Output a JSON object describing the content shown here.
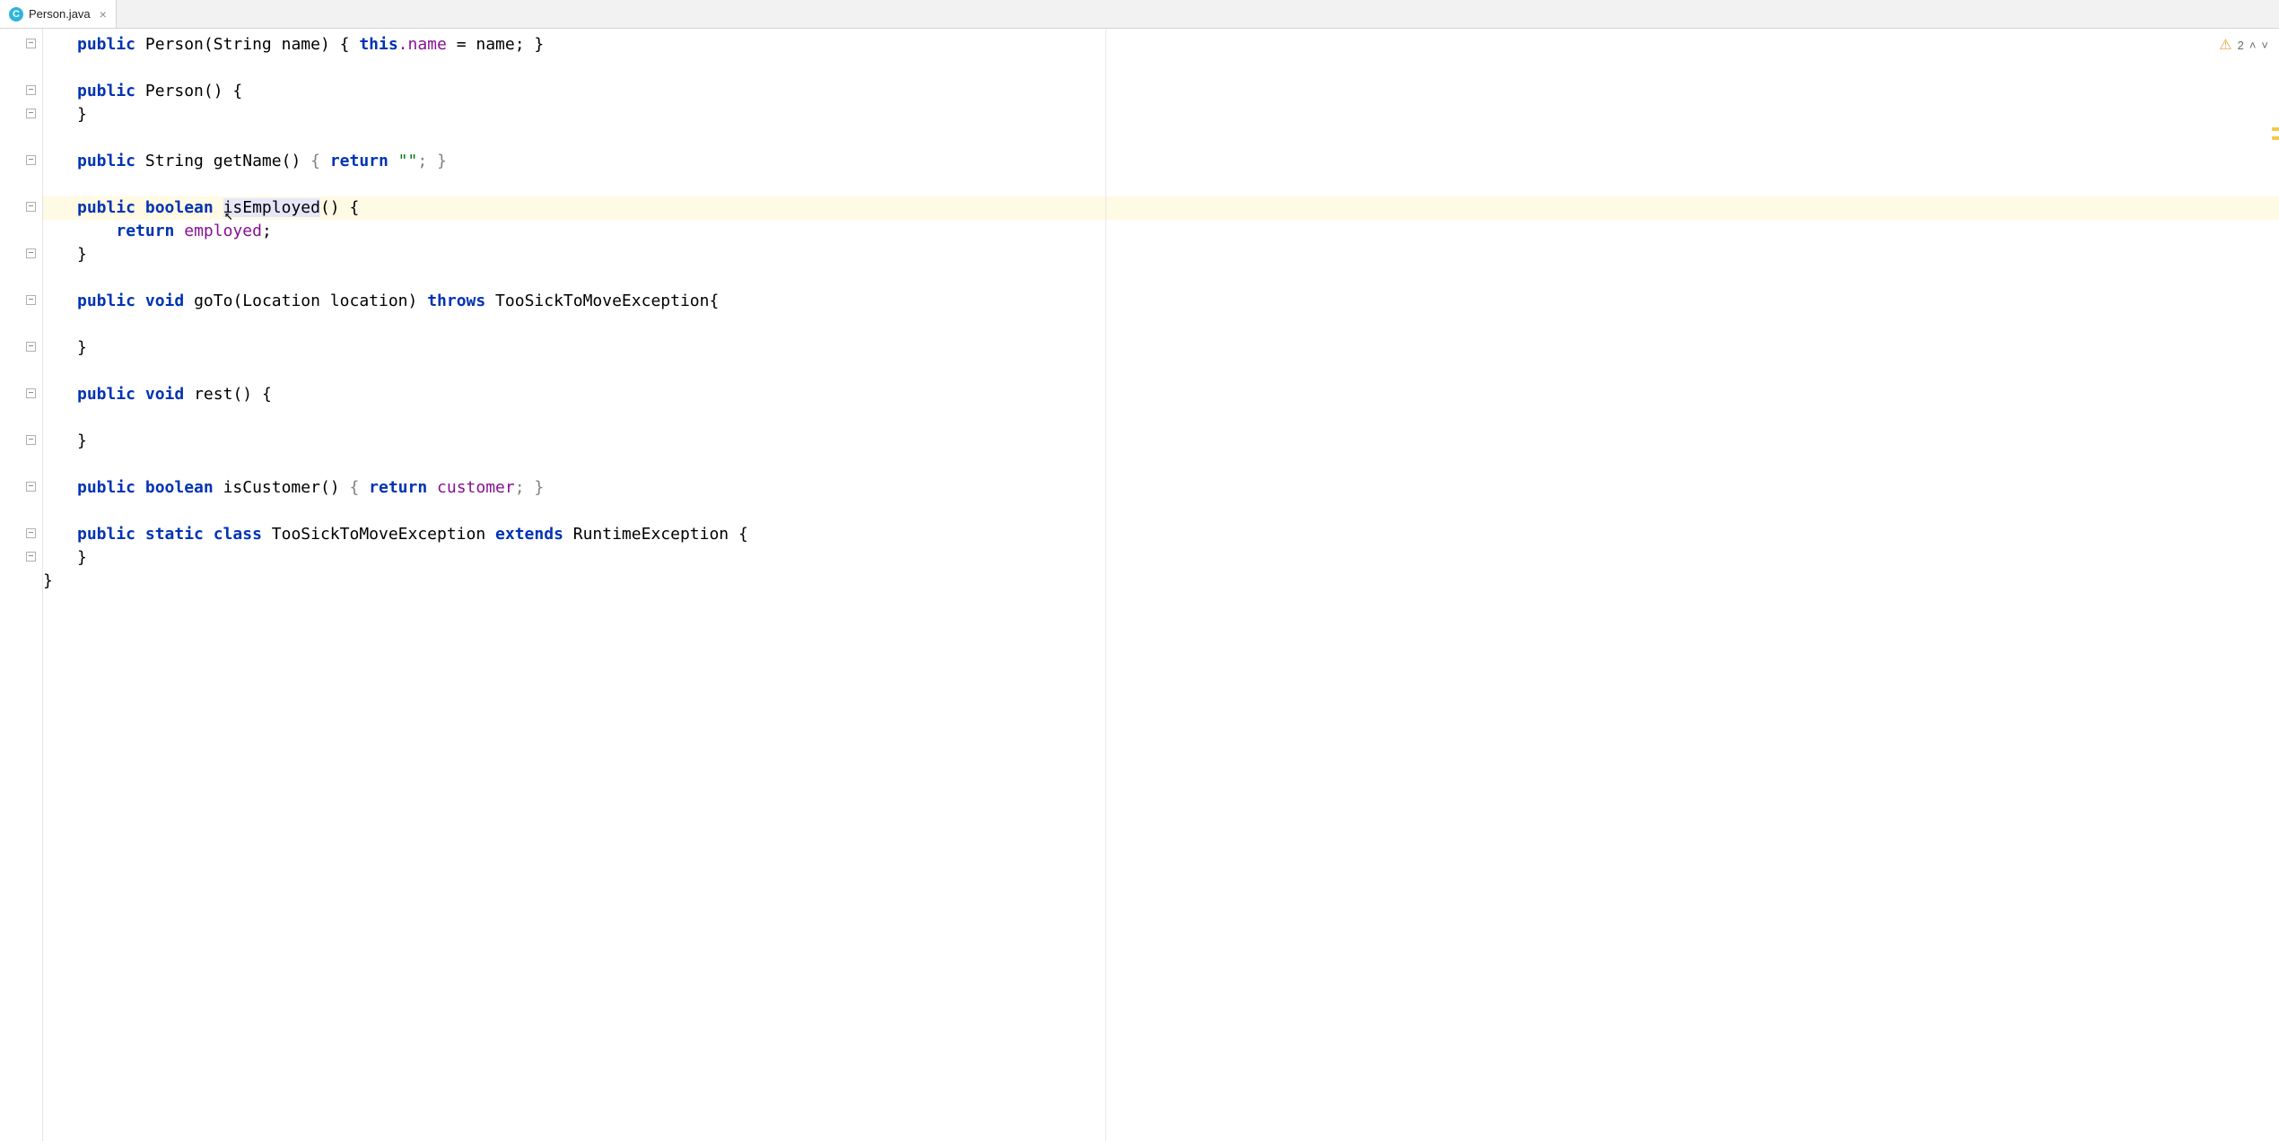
{
  "tab": {
    "icon_letter": "C",
    "filename": "Person.java"
  },
  "inspections": {
    "count": "2"
  },
  "code": {
    "line1": {
      "kw_public": "public",
      "ctor": "Person",
      "params_open": "(String name) {",
      "this": "this",
      "dot_name": ".name",
      "eq_name": " = name; }"
    },
    "line3": {
      "kw_public": "public",
      "ctor_sig": "Person() {"
    },
    "line4": {
      "brace": "}"
    },
    "line6": {
      "kw_public": "public",
      "ret_type": "String",
      "method": "getName",
      "paren": "() ",
      "brace_open": "{ ",
      "kw_return": "return",
      "str": " \"\"",
      "end": "; }"
    },
    "line8": {
      "kw_public": "public",
      "kw_boolean": "boolean",
      "method_pre": "i",
      "method_rest": "sEmployed",
      "paren": "() {"
    },
    "line9": {
      "kw_return": "return",
      "field": "employed",
      "semi": ";"
    },
    "line10": {
      "brace": "}"
    },
    "line12": {
      "kw_public": "public",
      "kw_void": "void",
      "method": "goTo",
      "params": "(Location location) ",
      "kw_throws": "throws",
      "exc": " TooSickToMoveException{"
    },
    "line14": {
      "brace": "}"
    },
    "line16": {
      "kw_public": "public",
      "kw_void": "void",
      "method": "rest",
      "paren": "() {"
    },
    "line18": {
      "brace": "}"
    },
    "line20": {
      "kw_public": "public",
      "kw_boolean": "boolean",
      "method": "isCustomer",
      "paren": "() ",
      "brace_open": "{ ",
      "kw_return": "return",
      "sp": " ",
      "field": "customer",
      "end": "; }"
    },
    "line22": {
      "kw_public": "public",
      "kw_static": "static",
      "kw_class": "class",
      "name": "TooSickToMoveException",
      "kw_extends": "extends",
      "super": "RuntimeException {"
    },
    "line23": {
      "brace": "}"
    },
    "line24": {
      "brace": "}"
    }
  }
}
